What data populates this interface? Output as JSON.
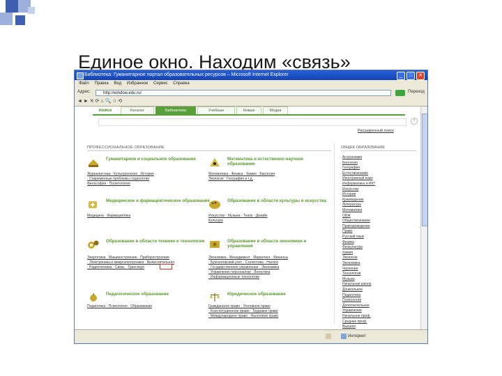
{
  "slide": {
    "title": "Единое окно. Находим «связь»"
  },
  "window": {
    "title": "Библиотека: Гуманитарное портал образовательных ресурсов – Microsoft Internet Explorer",
    "menu": [
      "Файл",
      "Правка",
      "Вид",
      "Избранное",
      "Сервис",
      "Справка"
    ],
    "address_label": "Адрес:",
    "address_value": "http://window.edu.ru/",
    "go_label": "Переход",
    "toolbar_icons": "◄ ► ✕ ⟳ ⌂  🔍 ☆ ⟲"
  },
  "site": {
    "tabs": [
      "поиск",
      "Каталог",
      "Библиотека",
      "Учебные",
      "Новые",
      "Медиа"
    ],
    "search_help": "?",
    "advanced_link": "Расширенный поиск",
    "section_head": "ПРОФЕССИОНАЛЬНОЕ ОБРАЗОВАНИЕ",
    "general_head": "ОБЩЕЕ ОБРАЗОВАНИЕ",
    "categories": [
      {
        "title": "Гуманитарное и социальное образование",
        "links": [
          "Журналистика · Культурология · История",
          "· Современные проблемы социологии",
          "Философия · Политология"
        ]
      },
      {
        "title": "Математика и естественно-научное образование",
        "links": [
          "Математика · Физика · Химия · Биология",
          "Экология · География и т.д."
        ]
      },
      {
        "title": "Медицинское и фармацевтическое образование",
        "links": [
          "Медицина · Фармацевтика"
        ]
      },
      {
        "title": "Образование в области культуры и искусства",
        "links": [
          "Искусство · Музыка · Театр · Дизайн",
          "Культура"
        ]
      },
      {
        "title": "Образование в области техники и технологии",
        "links": [
          "Энергетика · Машиностроение · Приборостроение",
          "· Электроника и микроэлектроника · Вычислительная",
          "· Радиотехника · Связь · Транспорт"
        ]
      },
      {
        "title": "Образование в области экономики и управления",
        "links": [
          "Экономика · Менеджмент · Маркетинг · Финансы",
          "· Бухгалтерский учет · Статистика · Налоги",
          "· Государственное управление · Экономика",
          "· Управление персоналом · Логистика",
          "· Информационные технологии"
        ]
      },
      {
        "title": "Педагогическое образование",
        "links": [
          "Педагогика · Психология · Образование"
        ]
      },
      {
        "title": "Юридическое образование",
        "links": [
          "Гражданское право · Уголовное право",
          "· Конституционное право · Трудовое право",
          "· Международное право · Налоговое право"
        ]
      }
    ],
    "general_items": [
      "Астрономия",
      "Биология",
      "География",
      "Естествознание",
      "Иностранный язык",
      "Информатика и ИКТ",
      "Искусство",
      "История",
      "Краеведение",
      "Литература",
      "Математика",
      "ОБЖ",
      "Обществознание",
      "Природоведение",
      "Право",
      "Русский язык",
      "Физика",
      "Физкультура",
      "Химия",
      "Экология",
      "Экономика",
      "Черчение",
      "Технология",
      "Музыка",
      "Начальная школа",
      "Дошкольное",
      "Педагогика",
      "Психология",
      "Дополнительное",
      "Управление",
      "Начальное проф.",
      "Среднее проф.",
      "Высшее",
      "Повышение квалиф.",
      "Школа",
      "Детский сад"
    ]
  },
  "status": {
    "zone": "Интернет"
  },
  "colors": {
    "accent_green": "#5aa03a",
    "title_blue": "#1242b8",
    "slide_square_blue": "#3d5fb0"
  }
}
